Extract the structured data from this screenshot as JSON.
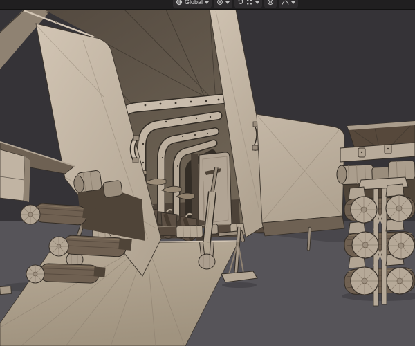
{
  "header": {
    "transform_orientation": {
      "label": "Global",
      "icon": "transform-orientation-global-icon",
      "dropdown": "chevron-down-icon"
    },
    "pivot_point": {
      "icon": "pivot-point-icon",
      "dropdown": "chevron-down-icon"
    },
    "snap": {
      "toggle_icon": "snap-magnet-icon",
      "targets_icon": "snap-increment-icon",
      "dropdown": "chevron-down-icon"
    },
    "proportional_editing": {
      "toggle_icon": "proportional-editing-circle-icon",
      "falloff_icon": "proportional-falloff-curve-icon",
      "dropdown": "chevron-down-icon"
    }
  },
  "viewport": {
    "content": "wireframe clay render of a dropship with open cargo bay, lowered loading ramp, interior rib frames with jump seats, and log-roller landing gear pods on both sides"
  },
  "colors": {
    "bg_top": "#353337",
    "floor": "#565459",
    "floor_shadow": "#49474c",
    "floor_shadow_dark": "#434146",
    "tan_bright": "#cfc2b1",
    "tan_light": "#c1b4a3",
    "tan_mid": "#a99c8b",
    "tan_dark": "#8f8272",
    "tan_deep": "#756856",
    "brown_dark": "#4c4238",
    "seat_brown": "#5d5044",
    "log_brown": "#6f6051",
    "hinge_brown": "#574a3e",
    "hopper_brown": "#56483b",
    "underside_brown": "#6e6153",
    "side_brown": "#827568",
    "hardware_dark": "#4f4438",
    "shadow_blue": "#4d5460",
    "wire": "#3c352d",
    "outline": "#332d26",
    "edge_highlight": "#d3c6b5",
    "wire_light": "#8d8070",
    "header_bg": "#201f20",
    "header_widget": "#2e2c2e",
    "header_text": "#d5d5d5",
    "header_icon": "#c0c0c0",
    "header_border": "#121212"
  }
}
